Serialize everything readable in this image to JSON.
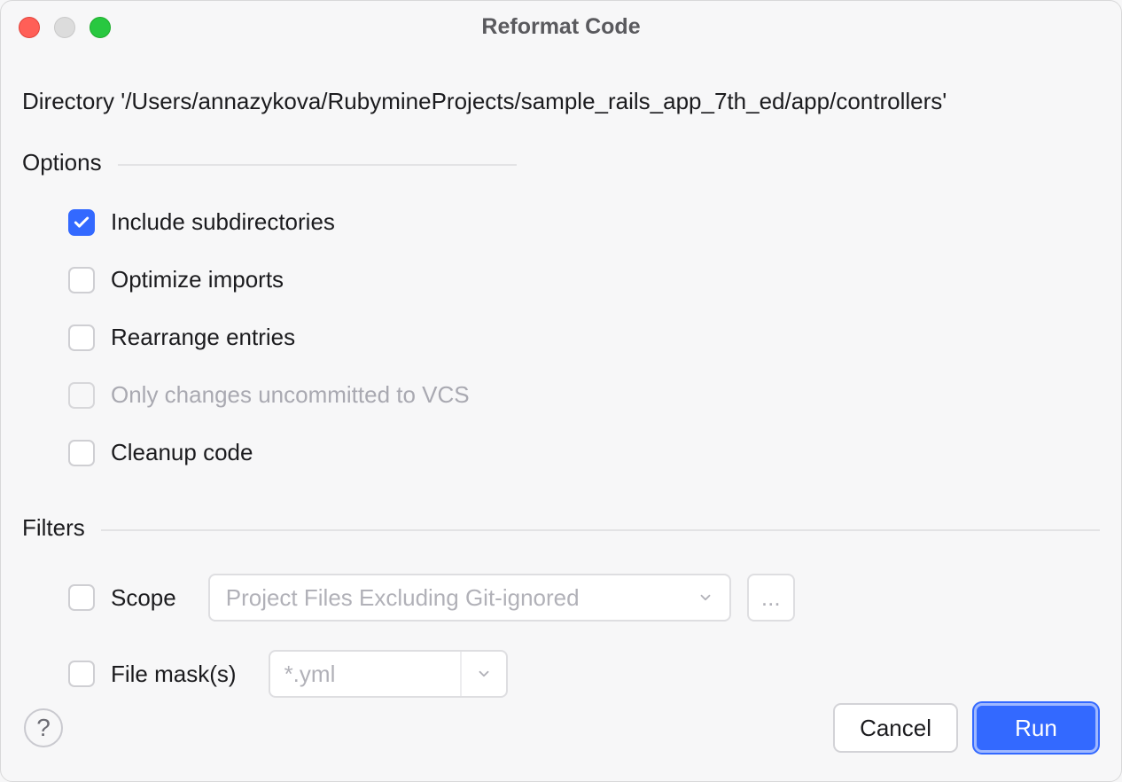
{
  "window": {
    "title": "Reformat Code"
  },
  "directory_label": "Directory '/Users/annazykova/RubymineProjects/sample_rails_app_7th_ed/app/controllers'",
  "options_heading": "Options",
  "options": {
    "include_subdirectories": {
      "label": "Include subdirectories",
      "checked": true,
      "disabled": false
    },
    "optimize_imports": {
      "label": "Optimize imports",
      "checked": false,
      "disabled": false
    },
    "rearrange_entries": {
      "label": "Rearrange entries",
      "checked": false,
      "disabled": false
    },
    "only_changes_vcs": {
      "label": "Only changes uncommitted to VCS",
      "checked": false,
      "disabled": true
    },
    "cleanup_code": {
      "label": "Cleanup code",
      "checked": false,
      "disabled": false
    }
  },
  "filters_heading": "Filters",
  "filters": {
    "scope": {
      "label": "Scope",
      "checked": false,
      "selected": "Project Files Excluding Git-ignored",
      "ellipsis": "..."
    },
    "file_mask": {
      "label": "File mask(s)",
      "checked": false,
      "value": "*.yml"
    }
  },
  "buttons": {
    "help": "?",
    "cancel": "Cancel",
    "run": "Run"
  }
}
